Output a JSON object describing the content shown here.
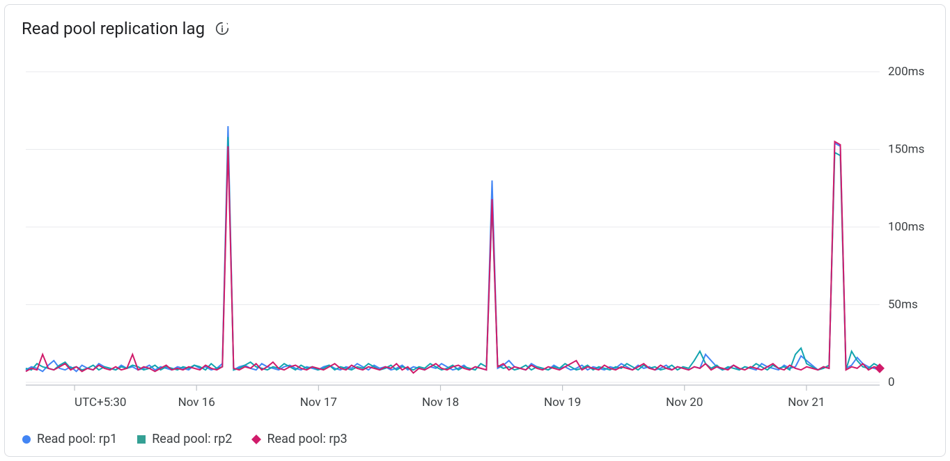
{
  "header": {
    "title": "Read pool replication lag",
    "info_tooltip": "Info / refresh"
  },
  "axis": {
    "tz_label": "UTC+5:30"
  },
  "legend": [
    {
      "label": "Read pool: rp1",
      "color": "#4285f4",
      "marker": "circle"
    },
    {
      "label": "Read pool: rp2",
      "color": "#34a094",
      "marker": "square"
    },
    {
      "label": "Read pool: rp3",
      "color": "#c5221f",
      "marker": "diamond",
      "real_color": "#d01b6a"
    }
  ],
  "chart_data": {
    "type": "line",
    "xlabel": "",
    "ylabel": "",
    "ylim": [
      0,
      200
    ],
    "y_unit": "ms",
    "y_ticks": [
      0,
      50,
      100,
      150,
      200
    ],
    "y_tick_labels": [
      "0",
      "50ms",
      "100ms",
      "150ms",
      "200ms"
    ],
    "x_tick_labels": [
      "UTC+5:30",
      "Nov 16",
      "Nov 17",
      "Nov 18",
      "Nov 19",
      "Nov 20",
      "Nov 21"
    ],
    "x_tick_positions": [
      0,
      1,
      2,
      3,
      4,
      5,
      6
    ],
    "x_range": [
      -0.4,
      6.6
    ],
    "series": [
      {
        "name": "Read pool: rp1",
        "color": "#4285f4",
        "values": [
          8,
          10,
          9,
          7,
          11,
          14,
          9,
          8,
          10,
          7,
          11,
          9,
          8,
          12,
          10,
          9,
          8,
          11,
          9,
          10,
          8,
          9,
          11,
          8,
          10,
          9,
          8,
          10,
          9,
          8,
          11,
          9,
          10,
          8,
          9,
          12,
          165,
          8,
          10,
          11,
          9,
          8,
          12,
          10,
          9,
          8,
          10,
          11,
          9,
          8,
          10,
          9,
          8,
          10,
          11,
          9,
          8,
          10,
          9,
          12,
          10,
          8,
          11,
          9,
          10,
          8,
          9,
          11,
          8,
          10,
          9,
          8,
          10,
          9,
          12,
          10,
          8,
          9,
          11,
          8,
          10,
          9,
          8,
          130,
          9,
          11,
          14,
          10,
          9,
          8,
          12,
          10,
          9,
          8,
          11,
          9,
          10,
          8,
          9,
          11,
          8,
          10,
          9,
          8,
          10,
          9,
          12,
          10,
          8,
          11,
          9,
          10,
          8,
          9,
          11,
          8,
          10,
          9,
          8,
          10,
          9,
          18,
          14,
          10,
          8,
          9,
          11,
          8,
          10,
          9,
          8,
          12,
          10,
          9,
          8,
          11,
          9,
          10,
          17,
          14,
          11,
          8,
          10,
          9,
          154,
          152,
          9,
          11,
          16,
          12,
          10,
          9,
          8
        ]
      },
      {
        "name": "Read pool: rp2",
        "color": "#12a4af",
        "values": [
          9,
          8,
          12,
          10,
          9,
          8,
          11,
          13,
          9,
          10,
          8,
          9,
          11,
          8,
          10,
          9,
          8,
          10,
          9,
          11,
          10,
          8,
          9,
          11,
          8,
          10,
          9,
          8,
          10,
          9,
          11,
          10,
          8,
          12,
          9,
          10,
          158,
          8,
          9,
          11,
          13,
          10,
          9,
          8,
          10,
          9,
          12,
          10,
          8,
          11,
          9,
          10,
          8,
          9,
          11,
          8,
          10,
          9,
          8,
          10,
          9,
          12,
          10,
          8,
          9,
          11,
          8,
          10,
          9,
          8,
          10,
          9,
          12,
          10,
          8,
          9,
          11,
          8,
          10,
          9,
          8,
          12,
          10,
          115,
          11,
          9,
          10,
          8,
          9,
          11,
          8,
          10,
          9,
          8,
          10,
          9,
          12,
          10,
          8,
          9,
          11,
          8,
          10,
          9,
          8,
          10,
          9,
          12,
          10,
          8,
          11,
          9,
          10,
          8,
          9,
          11,
          8,
          10,
          9,
          14,
          20,
          12,
          9,
          11,
          8,
          10,
          9,
          8,
          10,
          9,
          12,
          10,
          8,
          11,
          9,
          10,
          8,
          18,
          22,
          12,
          10,
          8,
          9,
          11,
          148,
          146,
          8,
          20,
          14,
          10,
          9,
          12,
          10
        ]
      },
      {
        "name": "Read pool: rp3",
        "color": "#d01b6a",
        "values": [
          7,
          9,
          8,
          18,
          9,
          8,
          10,
          12,
          8,
          10,
          7,
          9,
          8,
          11,
          9,
          8,
          10,
          8,
          9,
          18,
          8,
          10,
          9,
          7,
          9,
          11,
          8,
          9,
          8,
          10,
          9,
          8,
          11,
          9,
          8,
          10,
          152,
          9,
          8,
          10,
          9,
          12,
          8,
          10,
          13,
          9,
          8,
          10,
          11,
          9,
          8,
          10,
          9,
          8,
          10,
          12,
          9,
          8,
          11,
          9,
          8,
          10,
          9,
          8,
          10,
          9,
          12,
          8,
          10,
          6,
          9,
          8,
          10,
          12,
          9,
          8,
          10,
          11,
          9,
          8,
          10,
          9,
          8,
          118,
          10,
          12,
          8,
          10,
          9,
          8,
          11,
          9,
          8,
          10,
          9,
          8,
          10,
          12,
          14,
          8,
          10,
          9,
          8,
          11,
          9,
          8,
          10,
          9,
          8,
          10,
          12,
          9,
          8,
          11,
          9,
          8,
          10,
          9,
          8,
          10,
          9,
          12,
          8,
          10,
          9,
          8,
          11,
          9,
          8,
          10,
          9,
          8,
          10,
          12,
          9,
          8,
          11,
          9,
          8,
          10,
          9,
          8,
          10,
          9,
          155,
          153,
          8,
          10,
          9,
          12,
          8,
          10,
          9
        ]
      }
    ],
    "end_marker": {
      "series": "Read pool: rp3",
      "shape": "diamond",
      "color": "#d01b6a"
    }
  }
}
